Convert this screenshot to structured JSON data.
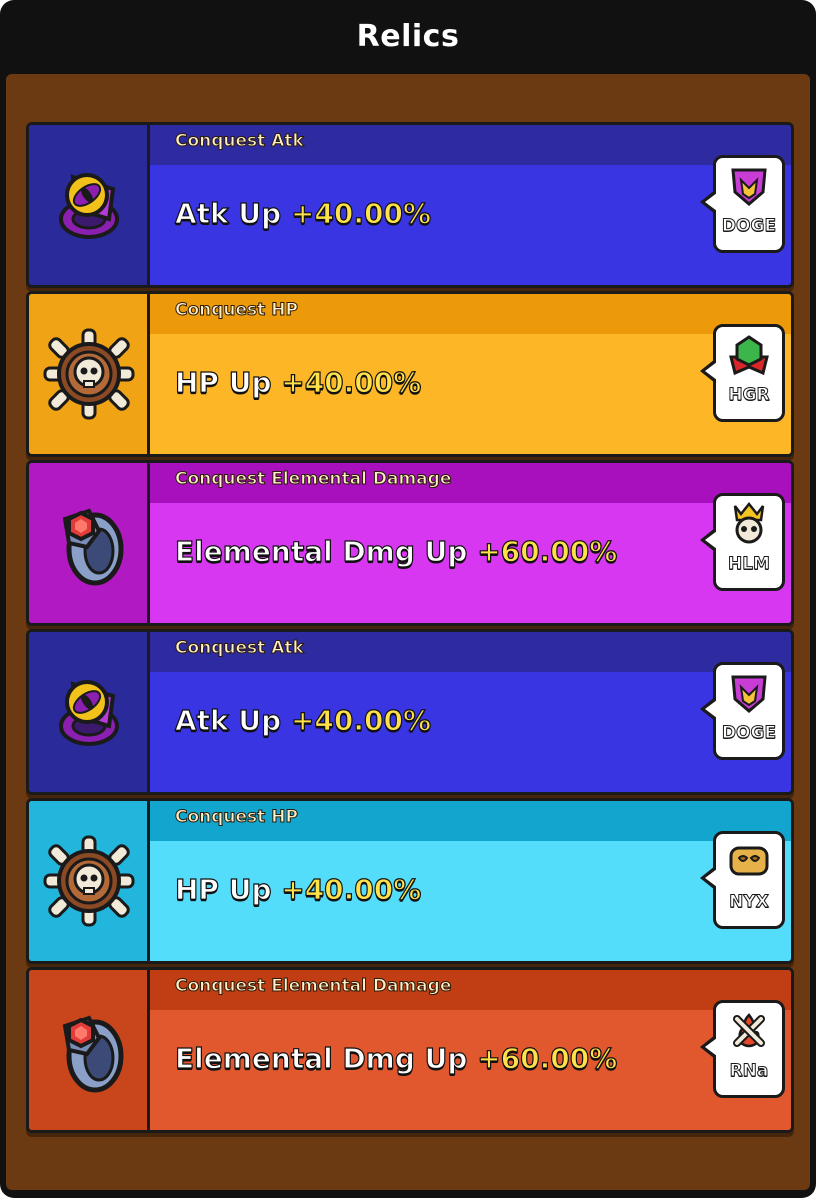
{
  "title": "Relics",
  "relics": [
    {
      "subtitle": "Conquest Atk",
      "stat": "Atk Up",
      "value": "+40.00%",
      "icon": "eye-gem-ring-icon",
      "guild_tag": "DOGE",
      "guild_emblem": "purple-shield-emblem-icon",
      "colors": {
        "left": "#2a2a9a",
        "top": "#2e2aa0",
        "main": "#3a35e2"
      }
    },
    {
      "subtitle": "Conquest HP",
      "stat": "HP Up",
      "value": "+40.00%",
      "icon": "skull-ship-wheel-icon",
      "guild_tag": "HGR",
      "guild_emblem": "green-gem-banner-emblem-icon",
      "colors": {
        "left": "#f1a316",
        "top": "#ec9a0a",
        "main": "#fdb626"
      }
    },
    {
      "subtitle": "Conquest Elemental Damage",
      "stat": "Elemental Dmg Up",
      "value": "+60.00%",
      "icon": "ruby-ring-icon",
      "guild_tag": "HLM",
      "guild_emblem": "crowned-skull-emblem-icon",
      "colors": {
        "left": "#b119c2",
        "top": "#a80fbd",
        "main": "#d737f0"
      }
    },
    {
      "subtitle": "Conquest Atk",
      "stat": "Atk Up",
      "value": "+40.00%",
      "icon": "eye-gem-ring-icon",
      "guild_tag": "DOGE",
      "guild_emblem": "purple-shield-emblem-icon",
      "colors": {
        "left": "#2a2a9a",
        "top": "#2e2aa0",
        "main": "#3a35e2"
      }
    },
    {
      "subtitle": "Conquest HP",
      "stat": "HP Up",
      "value": "+40.00%",
      "icon": "skull-ship-wheel-icon",
      "guild_tag": "NYX",
      "guild_emblem": "golden-mask-emblem-icon",
      "colors": {
        "left": "#22b6dc",
        "top": "#12a6cf",
        "main": "#54dcfb"
      }
    },
    {
      "subtitle": "Conquest Elemental Damage",
      "stat": "Elemental Dmg Up",
      "value": "+60.00%",
      "icon": "ruby-ring-icon",
      "guild_tag": "RNa",
      "guild_emblem": "crossed-bones-flame-emblem-icon",
      "colors": {
        "left": "#c9461c",
        "top": "#c13d14",
        "main": "#e1582e"
      }
    }
  ]
}
